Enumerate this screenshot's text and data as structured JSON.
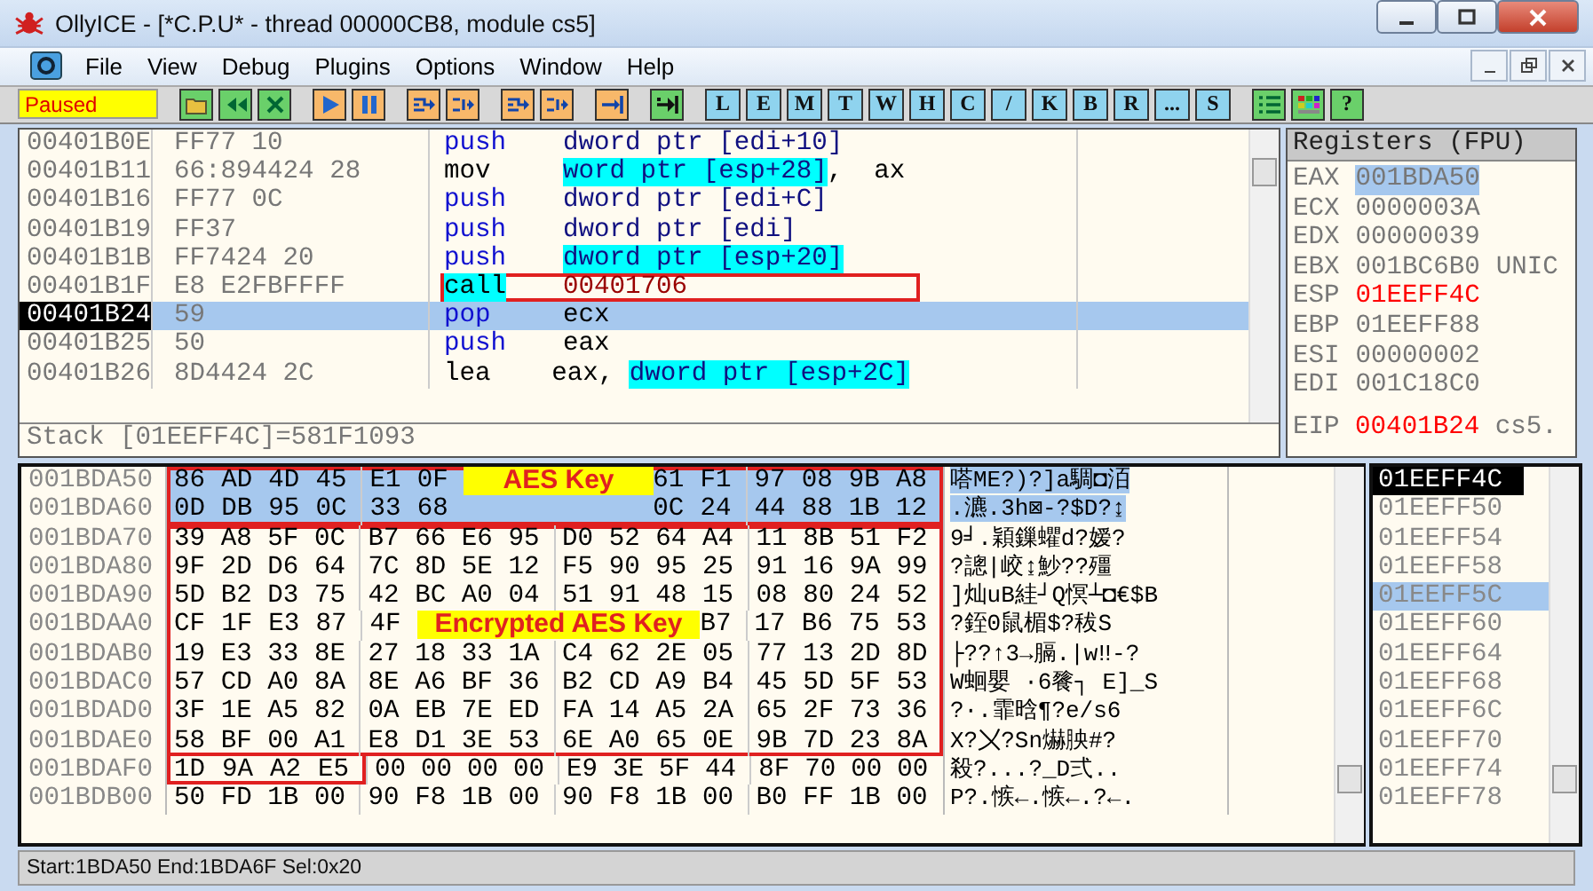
{
  "window": {
    "title": "OllyICE - [*C.P.U* - thread 00000CB8, module cs5]"
  },
  "menu": [
    "File",
    "View",
    "Debug",
    "Plugins",
    "Options",
    "Window",
    "Help"
  ],
  "toolbar": {
    "status": "Paused",
    "groups": [
      [
        {
          "kind": "open"
        },
        {
          "kind": "restart"
        },
        {
          "kind": "close"
        }
      ],
      [
        {
          "kind": "run"
        },
        {
          "kind": "pause"
        }
      ],
      [
        {
          "kind": "step-into"
        },
        {
          "kind": "step-over"
        }
      ],
      [
        {
          "kind": "trace-into"
        },
        {
          "kind": "trace-over"
        }
      ],
      [
        {
          "kind": "till-return"
        }
      ],
      [
        {
          "kind": "goto"
        }
      ],
      [
        {
          "kind": "letter",
          "label": "L"
        },
        {
          "kind": "letter",
          "label": "E"
        },
        {
          "kind": "letter",
          "label": "M"
        },
        {
          "kind": "letter",
          "label": "T"
        },
        {
          "kind": "letter",
          "label": "W"
        },
        {
          "kind": "letter",
          "label": "H"
        },
        {
          "kind": "letter",
          "label": "C"
        },
        {
          "kind": "letter",
          "label": "/"
        },
        {
          "kind": "letter",
          "label": "K"
        },
        {
          "kind": "letter",
          "label": "B"
        },
        {
          "kind": "letter",
          "label": "R"
        },
        {
          "kind": "letter",
          "label": "..."
        },
        {
          "kind": "letter",
          "label": "S"
        }
      ],
      [
        {
          "kind": "list"
        },
        {
          "kind": "colors"
        },
        {
          "kind": "help",
          "label": "?"
        }
      ]
    ]
  },
  "disassembly": {
    "rows": [
      {
        "address": "00401B0E",
        "hex": "FF77 10",
        "mnemonic": {
          "text": "push",
          "kind": "stack"
        },
        "operands": [
          {
            "text": "dword ptr [edi+10]",
            "kind": "mem"
          }
        ],
        "selected": false,
        "boxed": false
      },
      {
        "address": "00401B11",
        "hex": "66:894424 28",
        "mnemonic": {
          "text": "mov",
          "kind": "plain"
        },
        "operands": [
          {
            "text": "word ptr [esp+28]",
            "kind": "stackmem"
          },
          {
            "text": ",  ax",
            "kind": "plain"
          }
        ],
        "selected": false,
        "boxed": false
      },
      {
        "address": "00401B16",
        "hex": "FF77 0C",
        "mnemonic": {
          "text": "push",
          "kind": "stack"
        },
        "operands": [
          {
            "text": "dword ptr [edi+C]",
            "kind": "mem"
          }
        ],
        "selected": false,
        "boxed": false
      },
      {
        "address": "00401B19",
        "hex": "FF37",
        "mnemonic": {
          "text": "push",
          "kind": "stack"
        },
        "operands": [
          {
            "text": "dword ptr [edi]",
            "kind": "mem"
          }
        ],
        "selected": false,
        "boxed": false
      },
      {
        "address": "00401B1B",
        "hex": "FF7424 20",
        "mnemonic": {
          "text": "push",
          "kind": "stack"
        },
        "operands": [
          {
            "text": "dword ptr [esp+20]",
            "kind": "stackmem"
          }
        ],
        "selected": false,
        "boxed": false
      },
      {
        "address": "00401B1F",
        "hex": "E8 E2FBFFFF",
        "mnemonic": {
          "text": "call",
          "kind": "call"
        },
        "operands": [
          {
            "text": "00401706",
            "kind": "addr"
          }
        ],
        "selected": false,
        "boxed": true
      },
      {
        "address": "00401B24",
        "hex": "59",
        "mnemonic": {
          "text": "pop",
          "kind": "stack"
        },
        "operands": [
          {
            "text": "ecx",
            "kind": "plain"
          }
        ],
        "selected": true,
        "boxed": false
      },
      {
        "address": "00401B25",
        "hex": "50",
        "mnemonic": {
          "text": "push",
          "kind": "stack"
        },
        "operands": [
          {
            "text": "eax",
            "kind": "plain"
          }
        ],
        "selected": false,
        "boxed": false
      },
      {
        "address": "00401B26",
        "hex": "8D4424 2C",
        "mnemonic": {
          "text": "lea",
          "kind": "plain"
        },
        "operands": [
          {
            "text": "eax, ",
            "kind": "plain"
          },
          {
            "text": "dword ptr [esp+2C]",
            "kind": "stackmem"
          }
        ],
        "selected": false,
        "boxed": false
      }
    ],
    "info": "Stack [01EEFF4C]=581F1093"
  },
  "registers": {
    "title": "Registers (FPU)",
    "rows": [
      {
        "name": "EAX",
        "value": "001BDA50",
        "changed": false,
        "selected": true
      },
      {
        "name": "ECX",
        "value": "0000003A",
        "changed": false,
        "selected": false
      },
      {
        "name": "EDX",
        "value": "00000039",
        "changed": false,
        "selected": false
      },
      {
        "name": "EBX",
        "value": "001BC6B0",
        "comment": "UNIC",
        "changed": false,
        "selected": false
      },
      {
        "name": "ESP",
        "value": "01EEFF4C",
        "changed": true,
        "selected": false
      },
      {
        "name": "EBP",
        "value": "01EEFF88",
        "changed": false,
        "selected": false
      },
      {
        "name": "ESI",
        "value": "00000002",
        "changed": false,
        "selected": false
      },
      {
        "name": "EDI",
        "value": "001C18C0",
        "changed": false,
        "selected": false
      },
      {
        "name": "EIP",
        "value": "00401B24",
        "comment": "cs5.",
        "changed": true,
        "selected": false
      }
    ]
  },
  "dump": {
    "rows": [
      {
        "address": "001BDA50",
        "bytes": [
          "86",
          "AD",
          "4D",
          "45",
          "E1",
          "0F"
        ],
        "note": "AES Key",
        "bytes_after": [
          "61",
          "F1",
          "97",
          "08",
          "9B",
          "A8"
        ],
        "ascii": "嗒ME?)?]a騆◘洦",
        "selected": true,
        "kind": "key"
      },
      {
        "address": "001BDA60",
        "bytes": [
          "0D",
          "DB",
          "95",
          "0C",
          "33",
          "68"
        ],
        "bytes_after": [
          "0C",
          "24",
          "44",
          "88",
          "1B",
          "12"
        ],
        "ascii": ".瀌.3h⊠-?$D?↨",
        "selected": true,
        "kind": "key"
      },
      {
        "address": "001BDA70",
        "bytes": [
          "39",
          "A8",
          "5F",
          "0C",
          "B7",
          "66",
          "E6",
          "95",
          "D0",
          "52",
          "64",
          "A4",
          "11",
          "8B",
          "51",
          "F2"
        ],
        "ascii": "9╛.穎鏁蠷d?嫒?",
        "selected": false,
        "kind": "cipher"
      },
      {
        "address": "001BDA80",
        "bytes": [
          "9F",
          "2D",
          "D6",
          "64",
          "7C",
          "8D",
          "5E",
          "12",
          "F5",
          "90",
          "95",
          "25",
          "91",
          "16",
          "9A",
          "99"
        ],
        "ascii": "?謥|峧↨魦??殭",
        "selected": false,
        "kind": "cipher"
      },
      {
        "address": "001BDA90",
        "bytes": [
          "5D",
          "B2",
          "D3",
          "75",
          "42",
          "BC",
          "A0",
          "04",
          "51",
          "91",
          "48",
          "15",
          "08",
          "80",
          "24",
          "52"
        ],
        "ascii": "]灿uB絓┘Q慏┴◘€$B",
        "selected": false,
        "kind": "cipher"
      },
      {
        "address": "001BDAA0",
        "bytes": [
          "CF",
          "1F",
          "E3",
          "87",
          "4F"
        ],
        "note": "Encrypted AES Key",
        "bytes_after": [
          "B7",
          "17",
          "B6",
          "75",
          "53"
        ],
        "ascii": "?銍0鼠楣$?秡S",
        "selected": false,
        "kind": "cipher"
      },
      {
        "address": "001BDAB0",
        "bytes": [
          "19",
          "E3",
          "33",
          "8E",
          "27",
          "18",
          "33",
          "1A",
          "C4",
          "62",
          "2E",
          "05",
          "77",
          "13",
          "2D",
          "8D"
        ],
        "ascii": "├??↑3→膈.|w‼-?",
        "selected": false,
        "kind": "cipher"
      },
      {
        "address": "001BDAC0",
        "bytes": [
          "57",
          "CD",
          "A0",
          "8A",
          "8E",
          "A6",
          "BF",
          "36",
          "B2",
          "CD",
          "A9",
          "B4",
          "45",
          "5D",
          "5F",
          "53"
        ],
        "ascii": "W蛔嬰 ·6餮┐ E]_S",
        "selected": false,
        "kind": "cipher"
      },
      {
        "address": "001BDAD0",
        "bytes": [
          "3F",
          "1E",
          "A5",
          "82",
          "0A",
          "EB",
          "7E",
          "ED",
          "FA",
          "14",
          "A5",
          "2A",
          "65",
          "2F",
          "73",
          "36"
        ],
        "ascii": "?·.霏晗¶?e/s6",
        "selected": false,
        "kind": "cipher"
      },
      {
        "address": "001BDAE0",
        "bytes": [
          "58",
          "BF",
          "00",
          "A1",
          "E8",
          "D1",
          "3E",
          "53",
          "6E",
          "A0",
          "65",
          "0E",
          "9B",
          "7D",
          "23",
          "8A"
        ],
        "ascii": "X?〤?Sn爀胦#?",
        "selected": false,
        "kind": "cipher"
      },
      {
        "address": "001BDAF0",
        "bytes": [
          "1D",
          "9A",
          "A2",
          "E5",
          "00",
          "00",
          "00",
          "00",
          "E9",
          "3E",
          "5F",
          "44",
          "8F",
          "70",
          "00",
          "00"
        ],
        "ascii": "殺?...?_D弍..",
        "selected": false,
        "kind": "cipher-tail"
      },
      {
        "address": "001BDB00",
        "bytes": [
          "50",
          "FD",
          "1B",
          "00",
          "90",
          "F8",
          "1B",
          "00",
          "90",
          "F8",
          "1B",
          "00",
          "B0",
          "FF",
          "1B",
          "00"
        ],
        "ascii": "P?.愱←.愱←.?←.",
        "selected": false,
        "kind": "plain"
      }
    ]
  },
  "stack": {
    "rows": [
      {
        "address": "01EEFF4C",
        "current": true,
        "selected": false
      },
      {
        "address": "01EEFF50",
        "current": false,
        "selected": false
      },
      {
        "address": "01EEFF54",
        "current": false,
        "selected": false
      },
      {
        "address": "01EEFF58",
        "current": false,
        "selected": false
      },
      {
        "address": "01EEFF5C",
        "current": false,
        "selected": true
      },
      {
        "address": "01EEFF60",
        "current": false,
        "selected": false
      },
      {
        "address": "01EEFF64",
        "current": false,
        "selected": false
      },
      {
        "address": "01EEFF68",
        "current": false,
        "selected": false
      },
      {
        "address": "01EEFF6C",
        "current": false,
        "selected": false
      },
      {
        "address": "01EEFF70",
        "current": false,
        "selected": false
      },
      {
        "address": "01EEFF74",
        "current": false,
        "selected": false
      },
      {
        "address": "01EEFF78",
        "current": false,
        "selected": false
      }
    ]
  },
  "status_bar": "Start:1BDA50 End:1BDA6F Sel:0x20"
}
